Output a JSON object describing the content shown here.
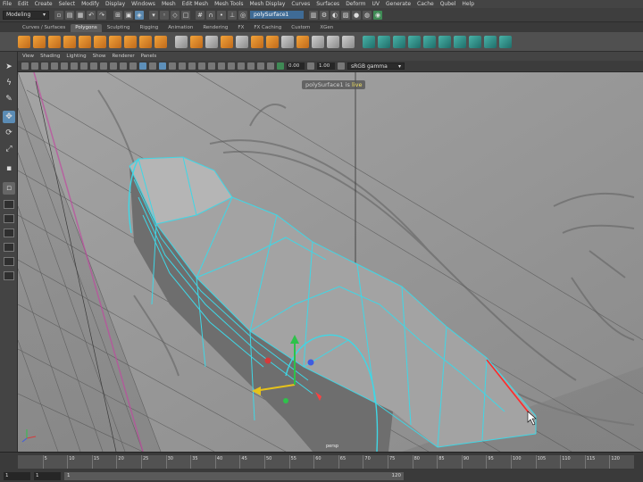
{
  "menubar": [
    "File",
    "Edit",
    "Create",
    "Select",
    "Modify",
    "Display",
    "Windows",
    "Mesh",
    "Edit Mesh",
    "Mesh Tools",
    "Mesh Display",
    "Curves",
    "Surfaces",
    "Deform",
    "UV",
    "Generate",
    "Cache",
    "Qubel",
    "Help"
  ],
  "statusline": {
    "mode": "Modeling",
    "live_object": "polySurface1"
  },
  "shelf_tabs": [
    "Curves / Surfaces",
    "Polygons",
    "Sculpting",
    "Rigging",
    "Animation",
    "Rendering",
    "FX",
    "FX Caching",
    "Custom",
    "XGen"
  ],
  "shelf_active_tab": "Polygons",
  "panel_menu": [
    "View",
    "Shading",
    "Lighting",
    "Show",
    "Renderer",
    "Panels"
  ],
  "panel_toolbar": {
    "field_a": "0.00",
    "field_b": "1.00",
    "color_space": "sRGB gamma"
  },
  "viewport": {
    "hud_object": "polySurface1",
    "hud_is": "is",
    "hud_live": "live",
    "camera": "persp"
  },
  "timeline": {
    "ticks": [
      5,
      10,
      15,
      20,
      25,
      30,
      35,
      40,
      45,
      50,
      55,
      60,
      65,
      70,
      75,
      80,
      85,
      90,
      95,
      100,
      105,
      110,
      115,
      120
    ]
  },
  "range": {
    "start": "1",
    "current": "1",
    "bar_start": "1",
    "bar_end": "120"
  },
  "colors": {
    "wire": "#3fd7e6",
    "accent": "#5b8cb5",
    "shelf_orange": "#f2a33a"
  }
}
